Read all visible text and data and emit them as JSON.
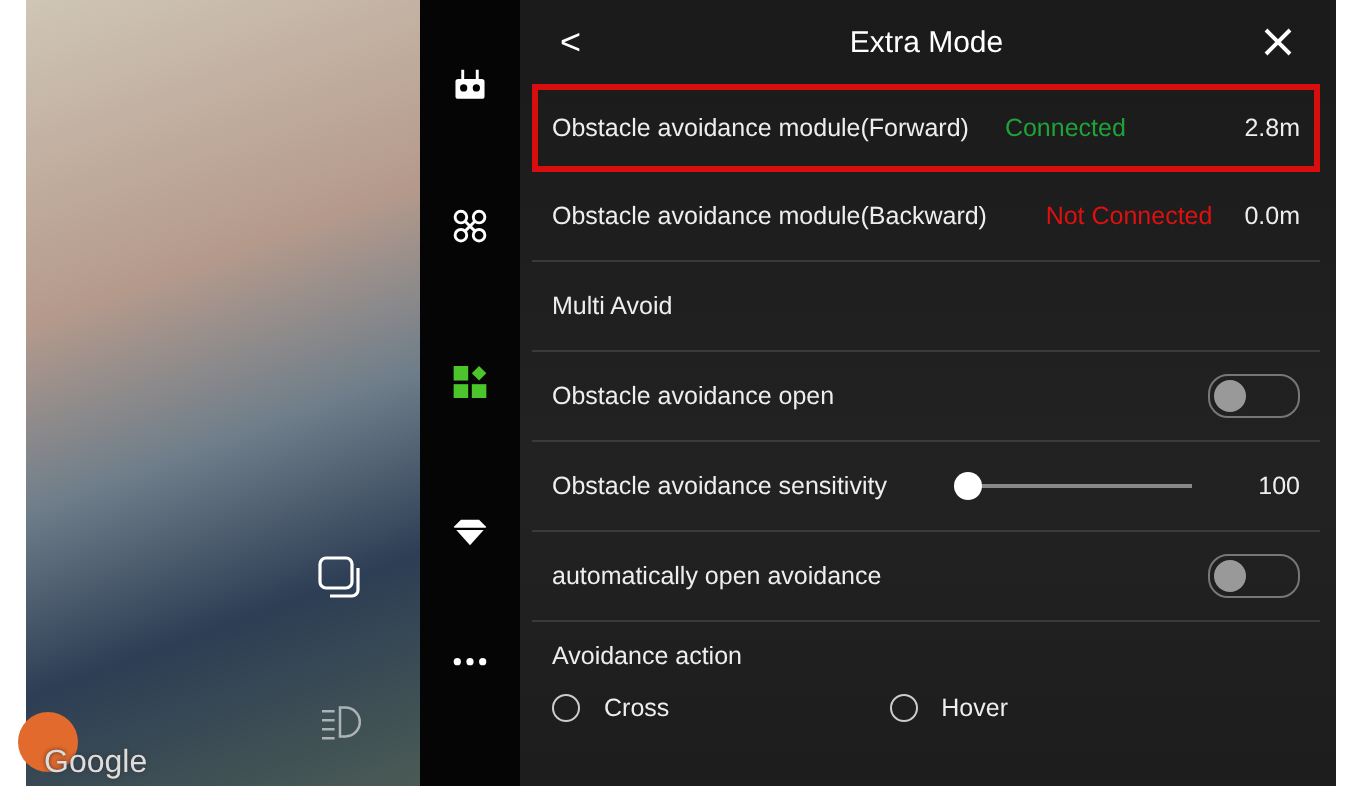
{
  "map": {
    "attribution": "Google"
  },
  "sidebar": {
    "items": [
      {
        "kind": "remote",
        "selected": false
      },
      {
        "kind": "drone",
        "selected": false
      },
      {
        "kind": "grid",
        "selected": true
      },
      {
        "kind": "gem",
        "selected": false
      },
      {
        "kind": "more",
        "selected": false
      }
    ]
  },
  "panel": {
    "title": "Extra Mode",
    "back": "<",
    "modules": [
      {
        "name": "Obstacle avoidance module(Forward)",
        "status": "Connected",
        "color": "#1fa339",
        "distance": "2.8m",
        "highlighted": true
      },
      {
        "name": "Obstacle avoidance module(Backward)",
        "status": "Not Connected",
        "color": "#e01010",
        "distance": "0.0m",
        "highlighted": false
      }
    ],
    "section": "Multi Avoid",
    "settings": [
      {
        "kind": "toggle",
        "label": "Obstacle avoidance open",
        "on": false
      },
      {
        "kind": "slider",
        "label": "Obstacle avoidance sensitivity",
        "level": 0,
        "reading": "100"
      },
      {
        "kind": "toggle",
        "label": "automatically open avoidance",
        "on": false
      }
    ],
    "action": {
      "label": "Avoidance action",
      "options": [
        {
          "label": "Cross",
          "selected": false
        },
        {
          "label": "Hover",
          "selected": false
        }
      ]
    }
  }
}
